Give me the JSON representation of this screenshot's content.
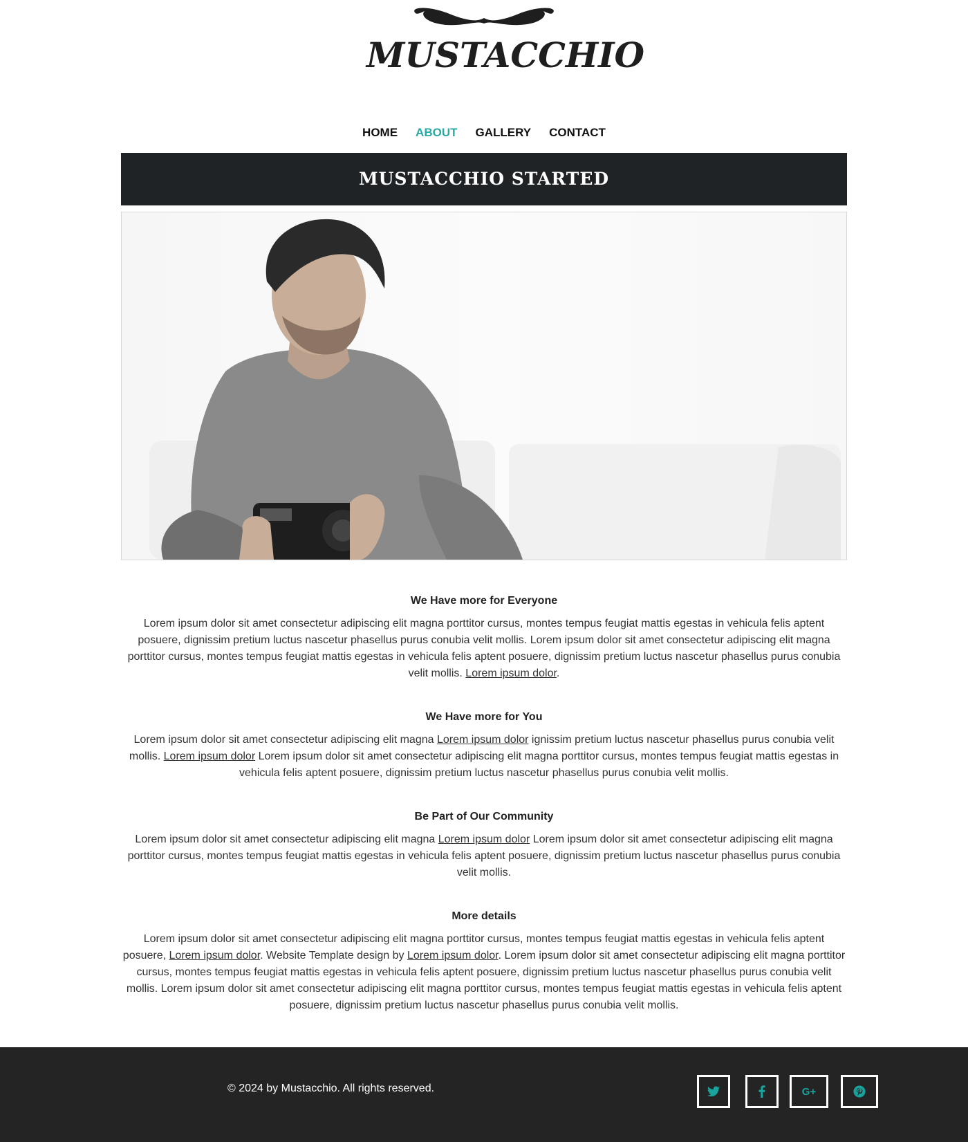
{
  "brand": {
    "logo_text": "MUSTACCHIO"
  },
  "nav": {
    "items": [
      {
        "label": "HOME",
        "active": false
      },
      {
        "label": "ABOUT",
        "active": true
      },
      {
        "label": "GALLERY",
        "active": false
      },
      {
        "label": "CONTACT",
        "active": false
      }
    ]
  },
  "banner": {
    "title": "MUSTACCHIO STARTED"
  },
  "sections": [
    {
      "heading": "We Have more for Everyone",
      "p1": "Lorem ipsum dolor sit amet consectetur adipiscing elit magna porttitor cursus, montes tempus feugiat mattis egestas in vehicula felis aptent posuere, dignissim pretium luctus nascetur phasellus purus conubia velit mollis. Lorem ipsum dolor sit amet consectetur adipiscing elit magna porttitor cursus, montes tempus feugiat mattis egestas in vehicula felis aptent posuere, dignissim pretium luctus nascetur phasellus purus conubia velit mollis. ",
      "link1": "Lorem ipsum dolor",
      "p2": "."
    },
    {
      "heading": "We Have more for You",
      "p1": "Lorem ipsum dolor sit amet consectetur adipiscing elit magna ",
      "link1": "Lorem ipsum dolor",
      "p2": " ignissim pretium luctus nascetur phasellus purus conubia velit mollis. ",
      "link2": "Lorem ipsum dolor",
      "p3": " Lorem ipsum dolor sit amet consectetur adipiscing elit magna porttitor cursus, montes tempus feugiat mattis egestas in vehicula felis aptent posuere, dignissim pretium luctus nascetur phasellus purus conubia velit mollis."
    },
    {
      "heading": "Be Part of Our Community",
      "p1": "Lorem ipsum dolor sit amet consectetur adipiscing elit magna ",
      "link1": "Lorem ipsum dolor",
      "p2": " Lorem ipsum dolor sit amet consectetur adipiscing elit magna porttitor cursus, montes tempus feugiat mattis egestas in vehicula felis aptent posuere, dignissim pretium luctus nascetur phasellus purus conubia velit mollis."
    },
    {
      "heading": "More details",
      "p1": "Lorem ipsum dolor sit amet consectetur adipiscing elit magna porttitor cursus, montes tempus feugiat mattis egestas in vehicula felis aptent posuere, ",
      "link1": "Lorem ipsum dolor",
      "p2": ". Website Template design by ",
      "link2": "Lorem ipsum dolor",
      "p3": ". Lorem ipsum dolor sit amet consectetur adipiscing elit magna porttitor cursus, montes tempus feugiat mattis egestas in vehicula felis aptent posuere, dignissim pretium luctus nascetur phasellus purus conubia velit mollis. Lorem ipsum dolor sit amet consectetur adipiscing elit magna porttitor cursus, montes tempus feugiat mattis egestas in vehicula felis aptent posuere, dignissim pretium luctus nascetur phasellus purus conubia velit mollis."
    }
  ],
  "footer": {
    "copyright": "© 2024 by Mustacchio. All rights reserved.",
    "social": [
      {
        "icon": "twitter-icon",
        "glyph": "t"
      },
      {
        "icon": "facebook-icon",
        "glyph": "f"
      },
      {
        "icon": "google-plus-icon",
        "glyph": "G+"
      },
      {
        "icon": "pinterest-icon",
        "glyph": "p"
      }
    ]
  },
  "colors": {
    "accent": "#2ba9a4",
    "banner_bg": "#1f2326",
    "footer_bg": "#242424"
  }
}
